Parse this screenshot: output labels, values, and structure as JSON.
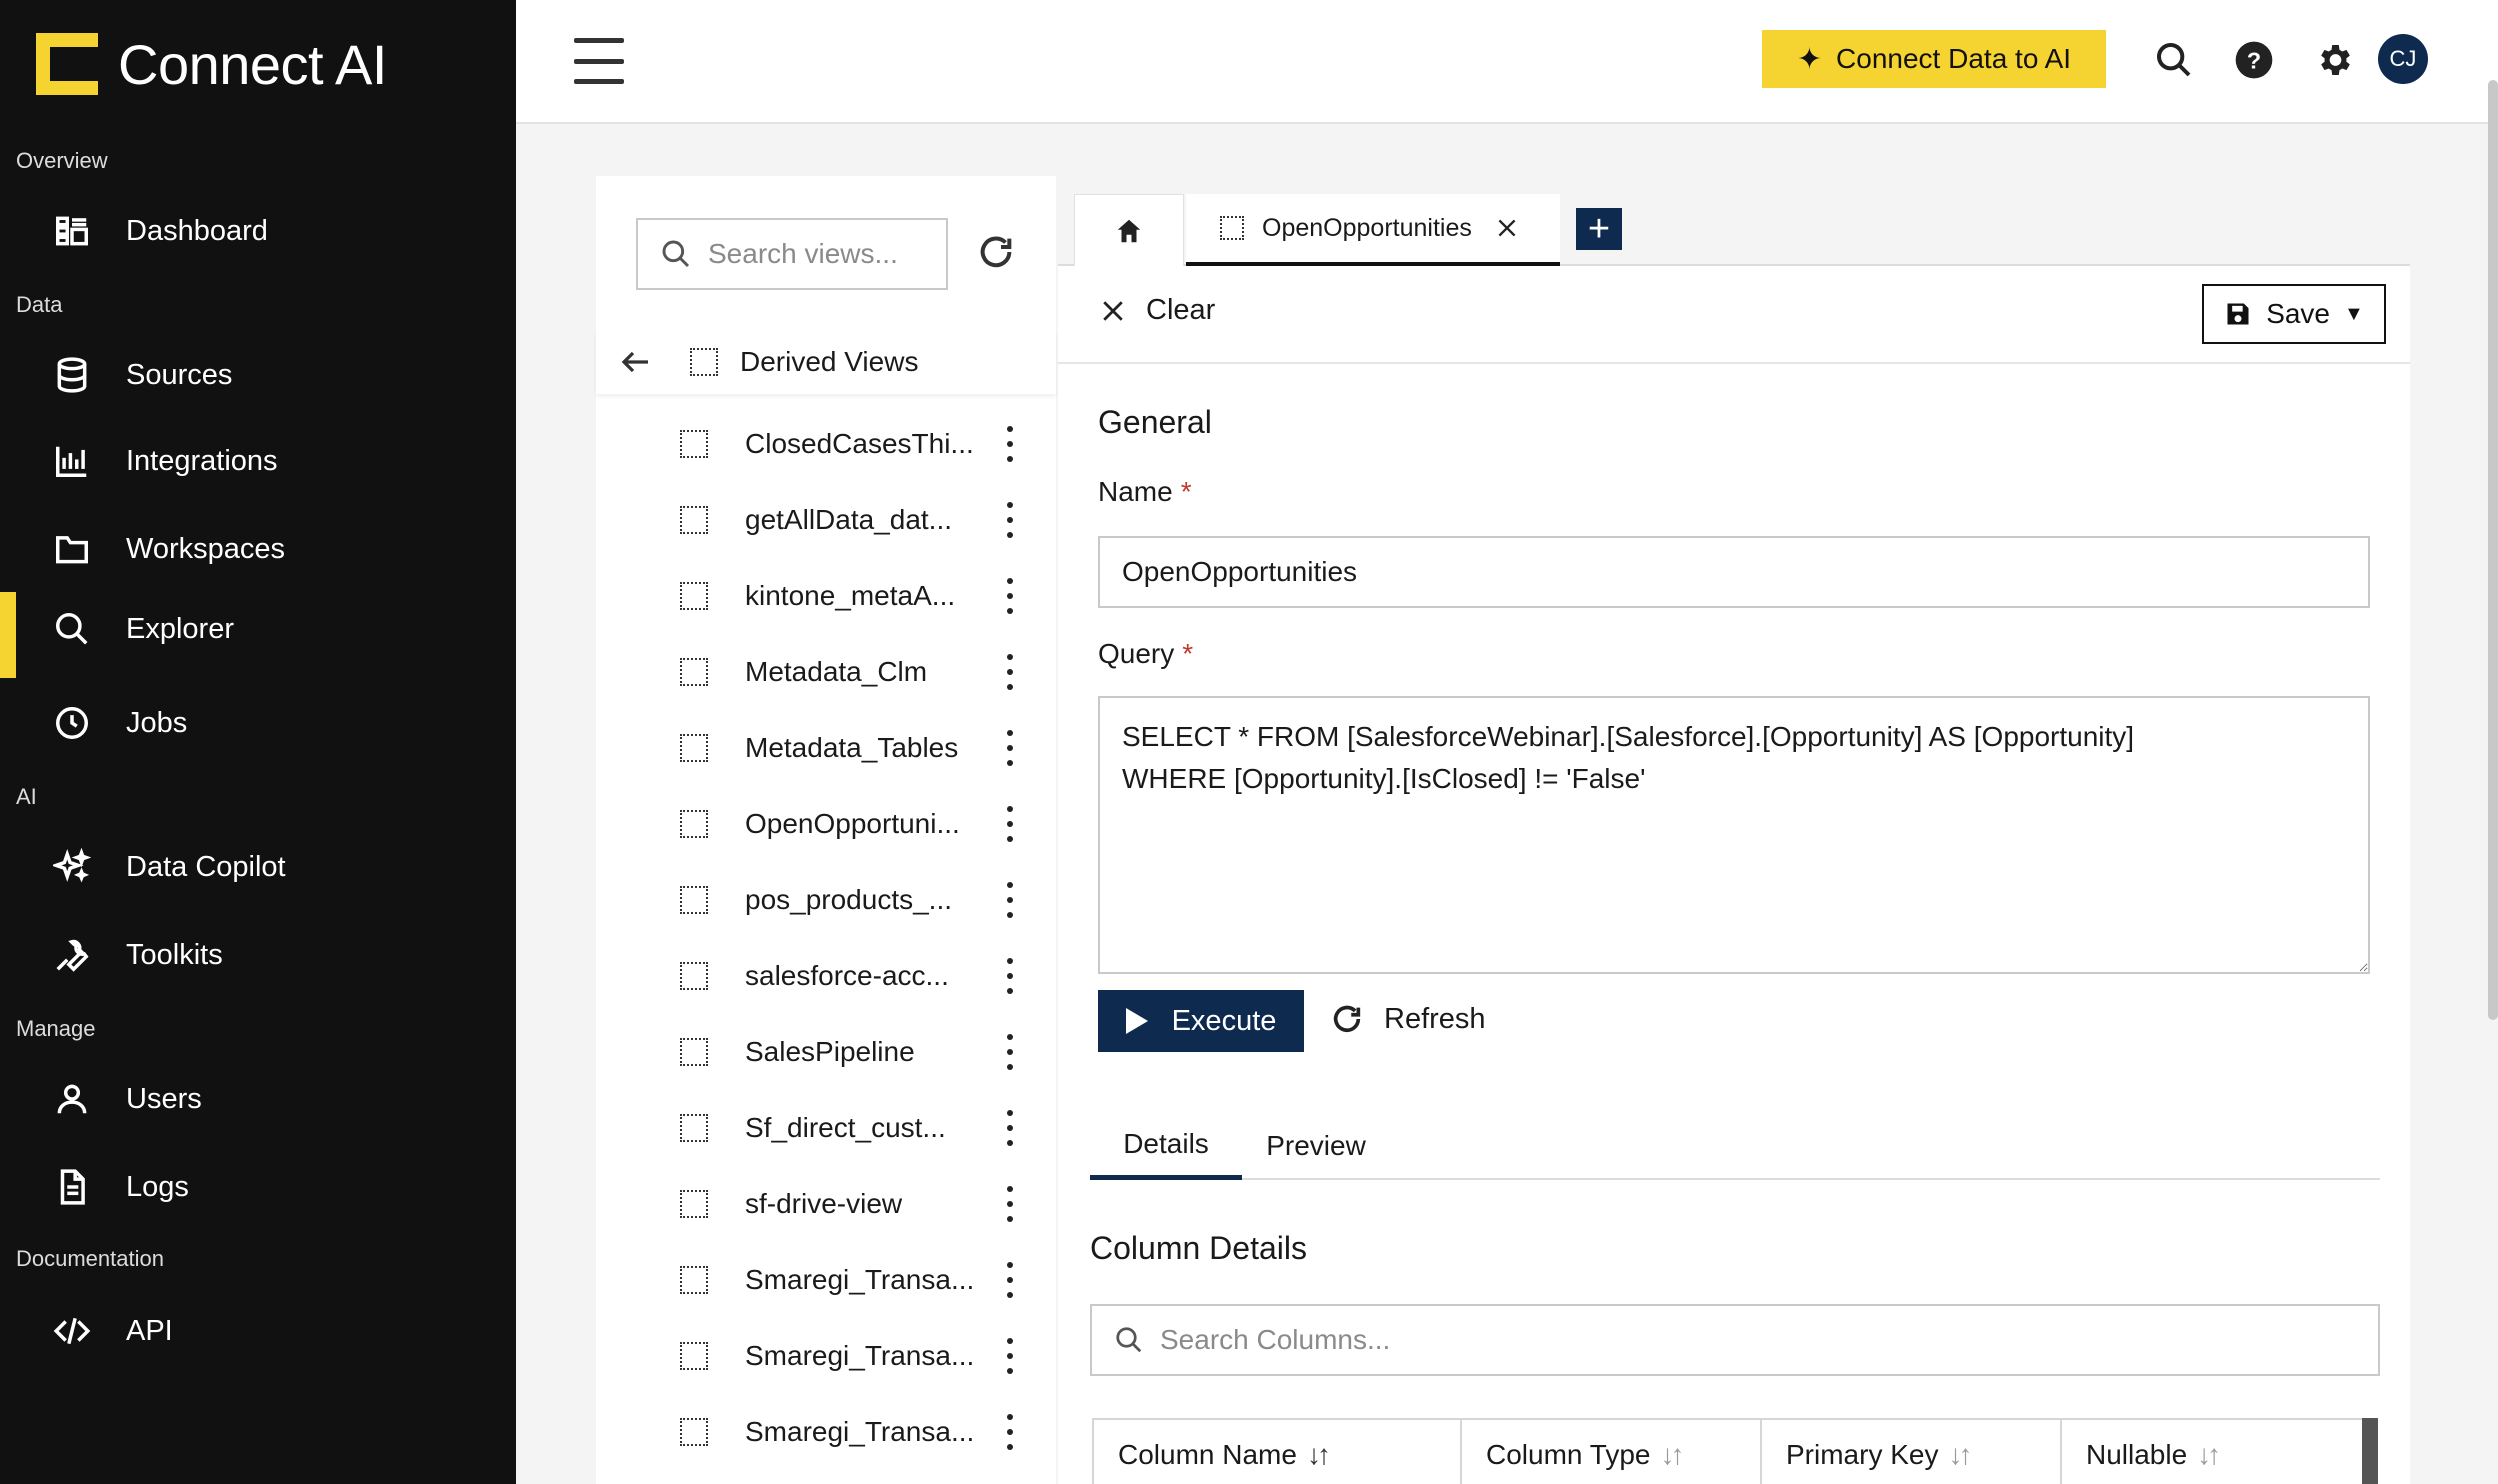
{
  "app": {
    "brand": "Connect AI"
  },
  "sidebar": {
    "sections": [
      {
        "label": "Overview"
      },
      {
        "label": "Data"
      },
      {
        "label": "AI"
      },
      {
        "label": "Manage"
      },
      {
        "label": "Documentation"
      }
    ],
    "items": [
      {
        "label": "Dashboard",
        "icon": "dashboard-icon"
      },
      {
        "label": "Sources",
        "icon": "database-icon"
      },
      {
        "label": "Integrations",
        "icon": "bar-chart-icon"
      },
      {
        "label": "Workspaces",
        "icon": "folder-icon"
      },
      {
        "label": "Explorer",
        "icon": "search-icon",
        "active": true
      },
      {
        "label": "Jobs",
        "icon": "clock-icon"
      },
      {
        "label": "Data Copilot",
        "icon": "sparkle-icon"
      },
      {
        "label": "Toolkits",
        "icon": "wrench-icon"
      },
      {
        "label": "Users",
        "icon": "user-icon"
      },
      {
        "label": "Logs",
        "icon": "document-icon"
      },
      {
        "label": "API",
        "icon": "code-icon"
      }
    ]
  },
  "header": {
    "connect_label": "Connect Data to AI",
    "avatar_initials": "CJ",
    "accent_color": "#f5d330",
    "navy_color": "#0e2a4f"
  },
  "views": {
    "search_placeholder": "Search views...",
    "folder_label": "Derived Views",
    "items": [
      "ClosedCasesThi...",
      "getAllData_dat...",
      "kintone_metaA...",
      "Metadata_Clm",
      "Metadata_Tables",
      "OpenOpportuni...",
      "pos_products_...",
      "salesforce-acc...",
      "SalesPipeline",
      "Sf_direct_cust...",
      "sf-drive-view",
      "Smaregi_Transa...",
      "Smaregi_Transa...",
      "Smaregi_Transa..."
    ]
  },
  "editor": {
    "tab_label": "OpenOpportunities",
    "clear_label": "Clear",
    "save_label": "Save",
    "general_title": "General",
    "name_label": "Name",
    "required_mark": "*",
    "name_value": "OpenOpportunities",
    "query_label": "Query",
    "query_value": "SELECT * FROM [SalesforceWebinar].[Salesforce].[Opportunity] AS [Opportunity]\nWHERE [Opportunity].[IsClosed] != 'False'",
    "execute_label": "Execute",
    "refresh_label": "Refresh",
    "sub_tabs": [
      "Details",
      "Preview"
    ],
    "column_details_title": "Column Details",
    "column_search_placeholder": "Search Columns...",
    "columns": [
      "Column Name",
      "Column Type",
      "Primary Key",
      "Nullable"
    ]
  }
}
